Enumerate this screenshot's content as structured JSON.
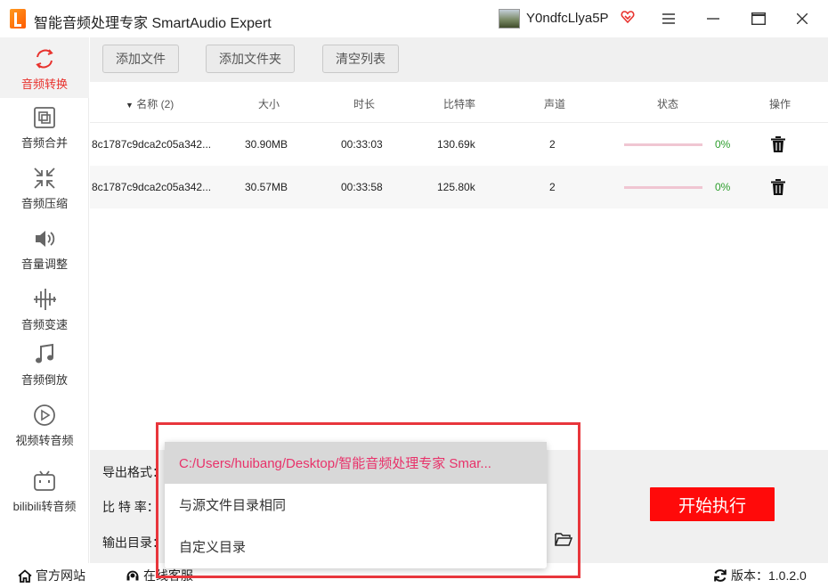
{
  "app": {
    "title": "智能音频处理专家 SmartAudio Expert"
  },
  "user": {
    "name": "Y0ndfcLlya5P"
  },
  "colors": {
    "accent": "#e8322d",
    "start_button": "#ff0a0a",
    "progress_green": "#2e9e2e",
    "dropdown_selected_text": "#e8326a"
  },
  "sidebar": {
    "items": [
      {
        "label": "音频转换",
        "icon": "convert-icon"
      },
      {
        "label": "音频合并",
        "icon": "merge-icon"
      },
      {
        "label": "音频压缩",
        "icon": "compress-icon"
      },
      {
        "label": "音量调整",
        "icon": "volume-icon"
      },
      {
        "label": "音频变速",
        "icon": "speed-icon"
      },
      {
        "label": "音频倒放",
        "icon": "music-note-icon"
      },
      {
        "label": "视频转音频",
        "icon": "play-icon"
      },
      {
        "label": "bilibili转音频",
        "icon": "bilibili-icon"
      }
    ]
  },
  "toolbar": {
    "add_file": "添加文件",
    "add_folder": "添加文件夹",
    "clear_list": "清空列表"
  },
  "table": {
    "headers": {
      "name": "名称 (2)",
      "size": "大小",
      "duration": "时长",
      "bitrate": "比特率",
      "channels": "声道",
      "status": "状态",
      "actions": "操作"
    },
    "rows": [
      {
        "name": "8c1787c9dca2c05a342...",
        "size": "30.90MB",
        "duration": "00:33:03",
        "bitrate": "130.69k",
        "channels": "2",
        "progress": "0%"
      },
      {
        "name": "8c1787c9dca2c05a342...",
        "size": "30.57MB",
        "duration": "00:33:58",
        "bitrate": "125.80k",
        "channels": "2",
        "progress": "0%"
      }
    ]
  },
  "settings": {
    "format_label": "导出格式：",
    "bitrate_label": "比 特 率：",
    "output_label": "输出目录：",
    "start_label": "开始执行"
  },
  "dropdown": {
    "options": [
      "C:/Users/huibang/Desktop/智能音频处理专家 Smar...",
      "与源文件目录相同",
      "自定义目录"
    ],
    "selected_index": 0
  },
  "statusbar": {
    "website": "官方网站",
    "support": "在线客服",
    "version": "版本：1.0.2.0"
  }
}
